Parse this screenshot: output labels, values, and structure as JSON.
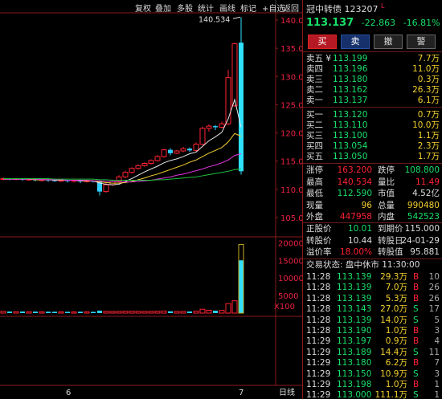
{
  "toolbar": [
    "复权",
    "叠加",
    "多股",
    "统计",
    "画线",
    "标记",
    "+自选",
    "返回"
  ],
  "chart_data": {
    "type": "candlestick",
    "y_axis_ticks": [
      "140.0",
      "135.0",
      "130.0",
      "125.0",
      "120.0",
      "115.0",
      "110.0",
      "105.0"
    ],
    "ylim": [
      102,
      141
    ],
    "high_label": "140.534",
    "volume_ticks": [
      "20000",
      "15000",
      "10000",
      "5000"
    ],
    "volume_unit": "X100",
    "volume_max": 21000,
    "x_labels": [
      "6",
      "7"
    ],
    "x_axis_label": "日线",
    "candles": [
      {
        "o": 111.8,
        "c": 111.9,
        "h": 112.1,
        "l": 111.6,
        "v": 500
      },
      {
        "o": 111.9,
        "c": 111.8,
        "h": 112.0,
        "l": 111.6,
        "v": 450
      },
      {
        "o": 111.8,
        "c": 111.9,
        "h": 112.0,
        "l": 111.6,
        "v": 420
      },
      {
        "o": 111.9,
        "c": 111.7,
        "h": 112.0,
        "l": 111.5,
        "v": 460
      },
      {
        "o": 111.7,
        "c": 111.8,
        "h": 112.0,
        "l": 111.5,
        "v": 400
      },
      {
        "o": 111.8,
        "c": 111.6,
        "h": 111.9,
        "l": 111.4,
        "v": 430
      },
      {
        "o": 111.6,
        "c": 111.7,
        "h": 111.9,
        "l": 111.4,
        "v": 380
      },
      {
        "o": 111.7,
        "c": 111.6,
        "h": 111.8,
        "l": 111.3,
        "v": 400
      },
      {
        "o": 111.6,
        "c": 111.5,
        "h": 111.8,
        "l": 111.3,
        "v": 390
      },
      {
        "o": 111.5,
        "c": 111.6,
        "h": 111.8,
        "l": 111.3,
        "v": 360
      },
      {
        "o": 111.6,
        "c": 111.5,
        "h": 111.7,
        "l": 111.2,
        "v": 370
      },
      {
        "o": 111.5,
        "c": 111.6,
        "h": 111.7,
        "l": 111.2,
        "v": 350
      },
      {
        "o": 111.6,
        "c": 111.4,
        "h": 111.7,
        "l": 111.1,
        "v": 400
      },
      {
        "o": 111.4,
        "c": 111.5,
        "h": 111.7,
        "l": 111.2,
        "v": 380
      },
      {
        "o": 111.5,
        "c": 111.4,
        "h": 111.6,
        "l": 111.2,
        "v": 360
      },
      {
        "o": 111.4,
        "c": 109.6,
        "h": 111.5,
        "l": 108.9,
        "v": 700
      },
      {
        "o": 109.6,
        "c": 110.8,
        "h": 111.1,
        "l": 109.4,
        "v": 520
      },
      {
        "o": 110.8,
        "c": 111.4,
        "h": 111.6,
        "l": 110.6,
        "v": 480
      },
      {
        "o": 111.4,
        "c": 112.2,
        "h": 112.5,
        "l": 111.2,
        "v": 500
      },
      {
        "o": 112.2,
        "c": 113.0,
        "h": 113.3,
        "l": 112.0,
        "v": 540
      },
      {
        "o": 113.0,
        "c": 113.7,
        "h": 113.9,
        "l": 112.8,
        "v": 560
      },
      {
        "o": 113.7,
        "c": 114.2,
        "h": 114.4,
        "l": 113.5,
        "v": 520
      },
      {
        "o": 114.2,
        "c": 114.6,
        "h": 114.8,
        "l": 114.0,
        "v": 500
      },
      {
        "o": 114.6,
        "c": 115.1,
        "h": 115.3,
        "l": 114.4,
        "v": 520
      },
      {
        "o": 115.1,
        "c": 115.8,
        "h": 116.1,
        "l": 114.9,
        "v": 540
      },
      {
        "o": 115.8,
        "c": 117.0,
        "h": 117.2,
        "l": 115.6,
        "v": 600
      },
      {
        "o": 117.0,
        "c": 116.4,
        "h": 117.3,
        "l": 116.0,
        "v": 520
      },
      {
        "o": 116.4,
        "c": 116.8,
        "h": 117.0,
        "l": 116.2,
        "v": 480
      },
      {
        "o": 116.8,
        "c": 117.2,
        "h": 117.5,
        "l": 116.6,
        "v": 500
      },
      {
        "o": 117.2,
        "c": 116.9,
        "h": 117.4,
        "l": 116.6,
        "v": 470
      },
      {
        "o": 116.9,
        "c": 118.0,
        "h": 118.3,
        "l": 116.7,
        "v": 560
      },
      {
        "o": 118.0,
        "c": 120.8,
        "h": 121.1,
        "l": 117.8,
        "v": 1100
      },
      {
        "o": 120.8,
        "c": 121.2,
        "h": 121.5,
        "l": 120.2,
        "v": 800
      },
      {
        "o": 121.2,
        "c": 121.0,
        "h": 121.4,
        "l": 120.5,
        "v": 700
      },
      {
        "o": 121.0,
        "c": 121.6,
        "h": 122.0,
        "l": 120.8,
        "v": 760
      },
      {
        "o": 121.6,
        "c": 129.8,
        "h": 131.2,
        "l": 121.4,
        "v": 2700
      },
      {
        "o": 124.8,
        "c": 135.8,
        "h": 136.0,
        "l": 124.6,
        "v": 3500
      },
      {
        "o": 136.0,
        "c": 113.2,
        "h": 140.5,
        "l": 112.6,
        "v": 15000
      }
    ],
    "ma_lines": [
      {
        "color": "#e8e8e8",
        "values": [
          111.8,
          111.8,
          111.8,
          111.8,
          111.8,
          111.7,
          111.7,
          111.7,
          111.6,
          111.6,
          111.6,
          111.6,
          111.5,
          111.5,
          111.5,
          111.1,
          110.9,
          110.8,
          110.9,
          111.4,
          111.9,
          112.5,
          113.1,
          113.6,
          114.1,
          114.7,
          115.1,
          115.4,
          115.8,
          116.3,
          116.6,
          117.6,
          118.6,
          119.3,
          120.1,
          122.5,
          125.9,
          121.0
        ]
      },
      {
        "color": "#f2cf2f",
        "values": [
          111.8,
          111.8,
          111.8,
          111.8,
          111.8,
          111.7,
          111.7,
          111.7,
          111.7,
          111.6,
          111.6,
          111.6,
          111.6,
          111.5,
          111.5,
          111.3,
          111.2,
          111.1,
          111.1,
          111.2,
          111.4,
          111.7,
          112.0,
          112.4,
          112.7,
          113.1,
          113.5,
          113.9,
          114.3,
          114.8,
          115.2,
          115.8,
          116.4,
          116.9,
          117.4,
          118.4,
          119.9,
          119.4
        ]
      },
      {
        "color": "#e034e0",
        "values": [
          111.8,
          111.8,
          111.8,
          111.8,
          111.8,
          111.8,
          111.7,
          111.7,
          111.7,
          111.7,
          111.6,
          111.6,
          111.6,
          111.6,
          111.5,
          111.5,
          111.4,
          111.4,
          111.3,
          111.3,
          111.3,
          111.4,
          111.5,
          111.6,
          111.8,
          112.0,
          112.2,
          112.5,
          112.7,
          113.0,
          113.3,
          113.6,
          114.0,
          114.3,
          114.7,
          115.2,
          116.0,
          116.3
        ]
      },
      {
        "color": "#1fbf3f",
        "values": [
          111.9,
          111.9,
          111.9,
          111.9,
          111.9,
          111.9,
          111.9,
          111.9,
          111.8,
          111.8,
          111.8,
          111.8,
          111.8,
          111.8,
          111.8,
          111.7,
          111.7,
          111.6,
          111.6,
          111.6,
          111.6,
          111.6,
          111.6,
          111.6,
          111.7,
          111.7,
          111.8,
          111.9,
          112.0,
          112.1,
          112.2,
          112.4,
          112.6,
          112.8,
          113.0,
          113.2,
          113.5,
          113.6
        ]
      }
    ]
  },
  "stock": {
    "name": "冠中转债",
    "code": "123207",
    "mark": "L",
    "price": "113.137",
    "change": "-22.863",
    "change_pct": "-16.81%"
  },
  "buttons": {
    "buy": "买",
    "sell": "卖",
    "cancel": "撤",
    "alert": "警"
  },
  "asks": [
    {
      "label": "卖五 ¥",
      "price": "113.199",
      "vol": "7.7万"
    },
    {
      "label": "卖四",
      "price": "113.196",
      "vol": "11.0万"
    },
    {
      "label": "卖三",
      "price": "113.180",
      "vol": "0.3万"
    },
    {
      "label": "卖二",
      "price": "113.162",
      "vol": "26.3万"
    },
    {
      "label": "卖一",
      "price": "113.137",
      "vol": "6.1万"
    }
  ],
  "bids": [
    {
      "label": "买一",
      "price": "113.120",
      "vol": "0.7万"
    },
    {
      "label": "买二",
      "price": "113.110",
      "vol": "10.0万"
    },
    {
      "label": "买三",
      "price": "113.100",
      "vol": "1.1万"
    },
    {
      "label": "买四",
      "price": "113.054",
      "vol": "2.3万"
    },
    {
      "label": "买五",
      "price": "113.050",
      "vol": "1.7万"
    }
  ],
  "stats": [
    {
      "k1": "涨停",
      "v1": "163.200",
      "c1": "red",
      "k2": "跌停",
      "v2": "108.800",
      "c2": "green"
    },
    {
      "k1": "最高",
      "v1": "140.534",
      "c1": "red",
      "k2": "量比",
      "v2": "11.49",
      "c2": "red"
    },
    {
      "k1": "最低",
      "v1": "112.590",
      "c1": "green",
      "k2": "市值",
      "v2": "4.52亿",
      "c2": "wht"
    },
    {
      "k1": "现量",
      "v1": "96",
      "c1": "yel",
      "k2": "总量",
      "v2": "990480",
      "c2": "yel"
    },
    {
      "k1": "外盘",
      "v1": "447958",
      "c1": "red",
      "k2": "内盘",
      "v2": "542523",
      "c2": "green"
    }
  ],
  "bond": [
    {
      "k1": "正股价",
      "v1": "10.01",
      "c1": "green",
      "k2": "到期价",
      "v2": "115.000",
      "c2": "wht"
    },
    {
      "k1": "转股价",
      "v1": "10.44",
      "c1": "wht",
      "k2": "转股日",
      "v2": "24-01-29",
      "c2": "wht"
    },
    {
      "k1": "溢价率",
      "v1": "18.00%",
      "c1": "red",
      "k2": "转股值",
      "v2": "95.881",
      "c2": "wht"
    }
  ],
  "status": {
    "label": "交易状态:",
    "value": "盘中休市",
    "time": "11:30:00"
  },
  "trades": [
    {
      "t": "11:28",
      "p": "113.139",
      "v": "29.3万",
      "d": "B",
      "n": "10"
    },
    {
      "t": "11:28",
      "p": "113.139",
      "v": "7.0万",
      "d": "B",
      "n": "26"
    },
    {
      "t": "11:28",
      "p": "113.139",
      "v": "5.3万",
      "d": "B",
      "n": "26"
    },
    {
      "t": "11:28",
      "p": "113.143",
      "v": "27.0万",
      "d": "S",
      "n": "17"
    },
    {
      "t": "11:28",
      "p": "113.139",
      "v": "14.0万",
      "d": "S",
      "n": "5"
    },
    {
      "t": "11:28",
      "p": "113.190",
      "v": "1.0万",
      "d": "B",
      "n": "3"
    },
    {
      "t": "11:29",
      "p": "113.197",
      "v": "0.9万",
      "d": "B",
      "n": "4"
    },
    {
      "t": "11:29",
      "p": "113.189",
      "v": "14.4万",
      "d": "S",
      "n": "11"
    },
    {
      "t": "11:29",
      "p": "113.180",
      "v": "6.2万",
      "d": "B",
      "n": "7"
    },
    {
      "t": "11:29",
      "p": "113.150",
      "v": "10.9万",
      "d": "S",
      "n": "3"
    },
    {
      "t": "11:29",
      "p": "113.198",
      "v": "1.0万",
      "d": "B",
      "n": "1"
    },
    {
      "t": "11:29",
      "p": "113.000",
      "v": "111.1万",
      "d": "S",
      "n": "1"
    }
  ]
}
